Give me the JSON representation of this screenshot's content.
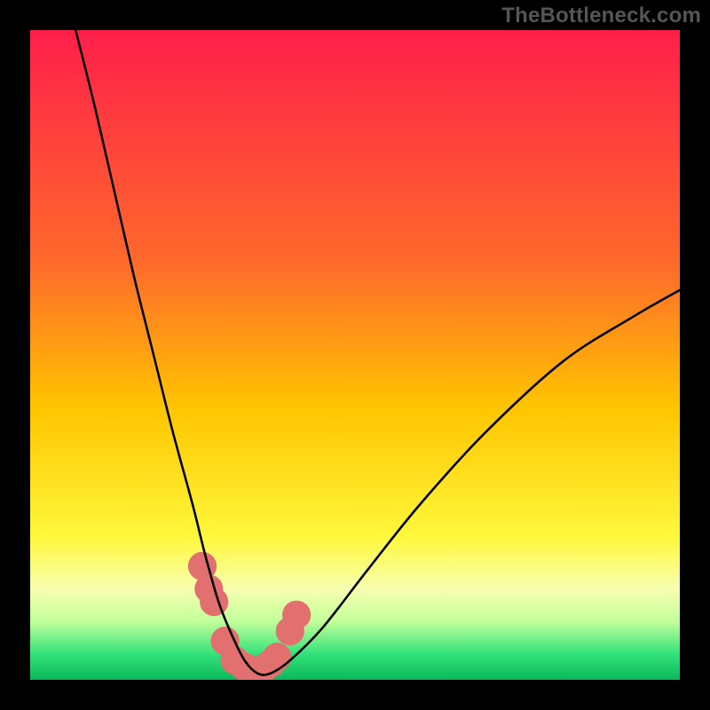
{
  "watermark": "TheBottleneck.com",
  "chart_data": {
    "type": "line",
    "title": "",
    "xlabel": "",
    "ylabel": "",
    "xlim": [
      0,
      100
    ],
    "ylim": [
      0,
      100
    ],
    "grid": false,
    "legend": false,
    "gradient_stops": [
      {
        "offset": 0.0,
        "color": "#ff1f4a"
      },
      {
        "offset": 0.36,
        "color": "#ff6a2b"
      },
      {
        "offset": 0.58,
        "color": "#ffc400"
      },
      {
        "offset": 0.78,
        "color": "#fff83b"
      },
      {
        "offset": 0.86,
        "color": "#f7ffb0"
      },
      {
        "offset": 0.91,
        "color": "#c2ff9a"
      },
      {
        "offset": 0.96,
        "color": "#34e27a"
      },
      {
        "offset": 1.0,
        "color": "#09b85a"
      }
    ],
    "series": [
      {
        "name": "bottleneck-curve",
        "x": [
          7,
          10,
          13,
          16,
          19,
          22,
          25,
          27,
          29,
          31,
          33,
          35,
          37,
          40,
          45,
          52,
          60,
          70,
          82,
          93,
          100
        ],
        "y": [
          100,
          88,
          75,
          62,
          50,
          38,
          27,
          19,
          12,
          7,
          3,
          1,
          1,
          3,
          8,
          17,
          27,
          38,
          49,
          56,
          60
        ]
      }
    ],
    "markers": {
      "name": "highlight-dots",
      "color": "#e1706e",
      "radius": 2.2,
      "x": [
        26.5,
        27.5,
        28.3,
        30.0,
        31.5,
        33.0,
        34.0,
        35.0,
        36.0,
        37.0,
        38.0,
        40.0,
        41.0
      ],
      "y": [
        17.5,
        14.0,
        12.0,
        6.0,
        3.0,
        2.0,
        1.5,
        1.5,
        1.8,
        2.5,
        3.5,
        7.5,
        10.0
      ]
    }
  }
}
